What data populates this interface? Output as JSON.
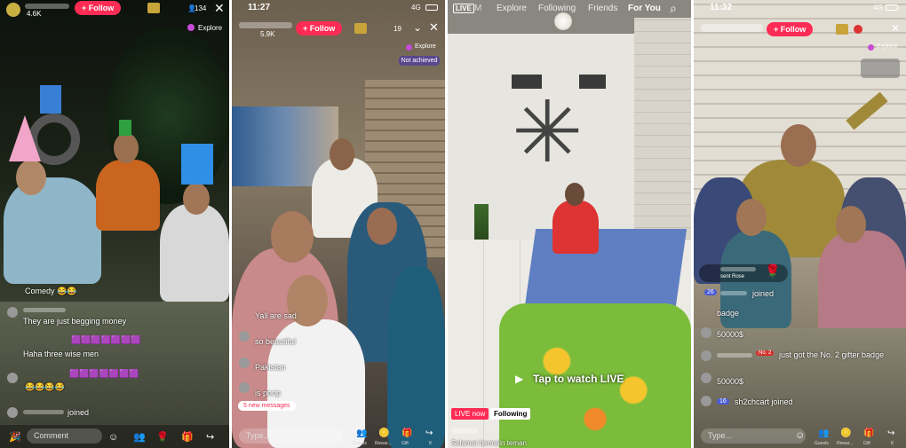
{
  "panel1": {
    "viewers": "4.6K",
    "follow": "+ Follow",
    "count": "134",
    "explore": "Explore",
    "comments": [
      {
        "text": "Comedy 😂😂"
      },
      {
        "text": "They are just begging money"
      },
      {
        "text": "Haha three wise men"
      },
      {
        "text": "😂😂😂😂"
      },
      {
        "text": "joined"
      }
    ],
    "comment_placeholder": "Comment"
  },
  "panel2": {
    "time": "11:27",
    "signal": "4G",
    "likes": "5.9K",
    "follow": "+ Follow",
    "count": "19",
    "explore": "Explore",
    "badge": "Not achieved",
    "comments": [
      {
        "text": "Yall are sad"
      },
      {
        "text": "so beautiful"
      },
      {
        "text": "Pakistan"
      },
      {
        "text": "is poop"
      }
    ],
    "new_messages": "5 new messages",
    "type_placeholder": "Type...",
    "bottom_labels": [
      "Guests",
      "Rewar...",
      "Gift",
      "8"
    ]
  },
  "panel3": {
    "live_tag": "LIVE",
    "tabs": [
      "M",
      "Explore",
      "Following",
      "Friends",
      "For You"
    ],
    "tap_text": "Tap to watch LIVE",
    "live_now": "LIVE now",
    "following": "Following",
    "caption": "Selamat bermain teman"
  },
  "panel4": {
    "time": "11:32",
    "signal": "4G",
    "follow": "+ Follow",
    "explore": "Explore",
    "gift_text": "sent Rose",
    "joined1": "26",
    "joined_word": "joined",
    "badge_text": "badge",
    "comments": [
      {
        "text": "50000$"
      },
      {
        "text": "No. 2"
      },
      {
        "text": "just got the No. 2 gifter badge"
      },
      {
        "text": "50000$"
      },
      {
        "text": "16"
      },
      {
        "text": "sh2chcart joined"
      }
    ],
    "type_placeholder": "Type...",
    "bottom_labels": [
      "Guests",
      "Rewar...",
      "Gift",
      "8"
    ]
  }
}
